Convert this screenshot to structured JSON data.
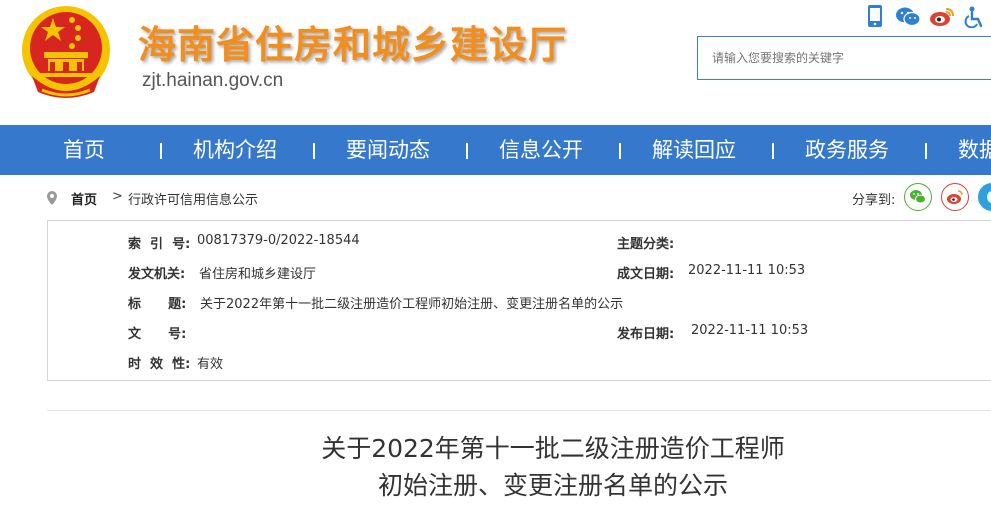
{
  "header": {
    "site_title": "海南省住房和城乡建设厅",
    "site_domain": "zjt.hainan.gov.cn",
    "icons": [
      "mobile-icon",
      "wechat-icon",
      "weibo-icon",
      "accessibility-icon"
    ]
  },
  "search": {
    "placeholder": "请输入您要搜索的关键字"
  },
  "nav": {
    "items": [
      "首页",
      "机构介绍",
      "要闻动态",
      "信息公开",
      "解读回应",
      "政务服务",
      "数据"
    ]
  },
  "breadcrumb": {
    "home": "首页",
    "separator": ">",
    "current": "行政许可信用信息公示"
  },
  "share": {
    "label": "分享到:",
    "targets": [
      "wechat",
      "weibo",
      "qq"
    ]
  },
  "meta": {
    "index_label": "索  引  号:",
    "index_value": "00817379-0/2022-18544",
    "topic_label": "主题分类:",
    "topic_value": "",
    "issuer_label": "发文机关:",
    "issuer_value": "省住房和城乡建设厅",
    "created_label": "成文日期:",
    "created_value": "2022-11-11 10:53",
    "title_label": "标      题:",
    "title_value": "关于2022年第十一批二级注册造价工程师初始注册、变更注册名单的公示",
    "docno_label": "文      号:",
    "docno_value": "",
    "published_label": "发布日期:",
    "published_value": "2022-11-11 10:53",
    "validity_label": "时  效  性:",
    "validity_value": "有效"
  },
  "article": {
    "title_line1": "关于2022年第十一批二级注册造价工程师",
    "title_line2": "初始注册、变更注册名单的公示"
  },
  "colors": {
    "nav_bg": "#3678cb",
    "title_orange": "#f28e1e",
    "emblem_red": "#d7261f",
    "emblem_gold": "#f5c400"
  }
}
